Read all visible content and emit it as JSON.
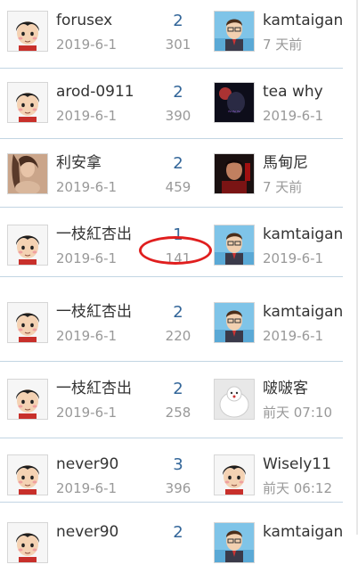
{
  "threads": [
    {
      "author": "forusex",
      "author_date": "2019-6-1",
      "replies": "2",
      "views": "301",
      "author_avatar": "cartoon-boy-icon",
      "last_poster": "kamtaigan",
      "last_date": "7 天前",
      "last_avatar": "cartoon-man-glasses-icon"
    },
    {
      "author": "arod-0911",
      "author_date": "2019-6-1",
      "replies": "2",
      "views": "390",
      "author_avatar": "cartoon-boy-icon",
      "last_poster": "tea why",
      "last_date": "2019-6-1",
      "last_avatar": "dark-photo-avatar-icon"
    },
    {
      "author": "利安拿",
      "author_date": "2019-6-1",
      "replies": "2",
      "views": "459",
      "author_avatar": "woman-photo-avatar-icon",
      "last_poster": "馬甸尼",
      "last_date": "7 天前",
      "last_avatar": "man-photo-avatar-icon"
    },
    {
      "author": "一枝紅杏出",
      "author_date": "2019-6-1",
      "replies": "1",
      "views": "141",
      "author_avatar": "cartoon-boy-icon",
      "last_poster": "kamtaigan",
      "last_date": "2019-6-1",
      "last_avatar": "cartoon-man-glasses-icon"
    },
    {
      "author": "一枝紅杏出",
      "author_date": "2019-6-1",
      "replies": "2",
      "views": "220",
      "author_avatar": "cartoon-boy-icon",
      "last_poster": "kamtaigan",
      "last_date": "2019-6-1",
      "last_avatar": "cartoon-man-glasses-icon"
    },
    {
      "author": "一枝紅杏出",
      "author_date": "2019-6-1",
      "replies": "2",
      "views": "258",
      "author_avatar": "cartoon-boy-icon",
      "last_poster": "啵啵客",
      "last_date": "前天 07:10",
      "last_avatar": "white-cat-avatar-icon"
    },
    {
      "author": "never90",
      "author_date": "2019-6-1",
      "replies": "3",
      "views": "396",
      "author_avatar": "cartoon-boy-icon",
      "last_poster": "Wisely11",
      "last_date": "前天 06:12",
      "last_avatar": "cartoon-boy-icon"
    },
    {
      "author": "never90",
      "author_date": "",
      "replies": "2",
      "views": "",
      "author_avatar": "cartoon-boy-icon",
      "last_poster": "kamtaigan",
      "last_date": "",
      "last_avatar": "cartoon-man-glasses-icon"
    }
  ],
  "annotation": {
    "color": "#e01e1e",
    "highlighted_views": "141"
  },
  "colors": {
    "separator": "#c2d5e3",
    "replies": "#336699",
    "muted": "#999999",
    "text": "#333333"
  }
}
